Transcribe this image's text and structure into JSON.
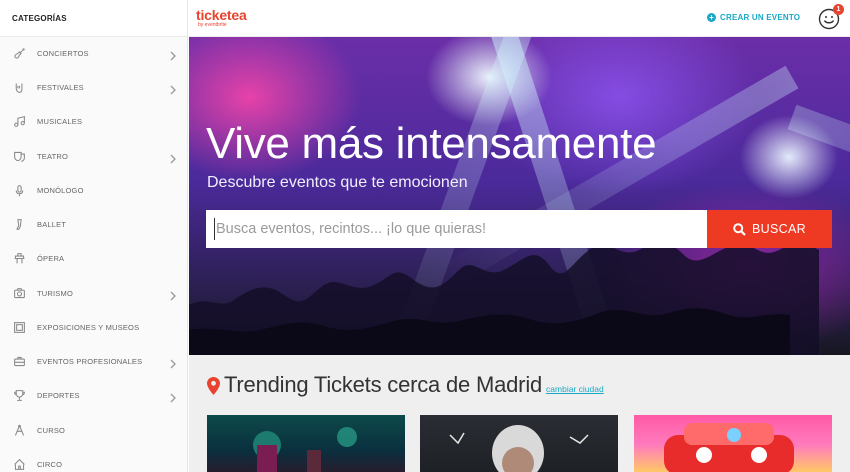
{
  "sidebar": {
    "heading": "CATEGORÍAS",
    "items": [
      {
        "label": "CONCIERTOS",
        "icon": "guitar-icon",
        "has_children": true
      },
      {
        "label": "FESTIVALES",
        "icon": "rock-hand-icon",
        "has_children": true
      },
      {
        "label": "MUSICALES",
        "icon": "music-note-icon",
        "has_children": false
      },
      {
        "label": "TEATRO",
        "icon": "theater-masks-icon",
        "has_children": true
      },
      {
        "label": "MONÓLOGO",
        "icon": "microphone-icon",
        "has_children": false
      },
      {
        "label": "BALLET",
        "icon": "ballet-shoe-icon",
        "has_children": false
      },
      {
        "label": "ÓPERA",
        "icon": "opera-icon",
        "has_children": false
      },
      {
        "label": "TURISMO",
        "icon": "camera-icon",
        "has_children": true
      },
      {
        "label": "EXPOSICIONES Y MUSEOS",
        "icon": "frame-icon",
        "has_children": false
      },
      {
        "label": "EVENTOS PROFESIONALES",
        "icon": "briefcase-icon",
        "has_children": true
      },
      {
        "label": "DEPORTES",
        "icon": "trophy-icon",
        "has_children": true
      },
      {
        "label": "CURSO",
        "icon": "compass-icon",
        "has_children": false
      },
      {
        "label": "CIRCO",
        "icon": "circus-icon",
        "has_children": false
      }
    ]
  },
  "header": {
    "logo_text": "ticketea",
    "logo_sub": "by eventbrite",
    "create_event_label": "CREAR UN EVENTO",
    "notification_count": "1"
  },
  "hero": {
    "title": "Vive más intensamente",
    "subtitle": "Descubre eventos que te emocionen",
    "search_placeholder": "Busca eventos, recintos... ¡lo que quieras!",
    "search_value": "",
    "search_button_label": "BUSCAR"
  },
  "trending": {
    "title": "Trending Tickets cerca de Madrid",
    "change_city_label": "cambiar ciudad"
  },
  "colors": {
    "brand": "#e8432e",
    "accent": "#1aa8c6",
    "search_button": "#ee3a22"
  }
}
